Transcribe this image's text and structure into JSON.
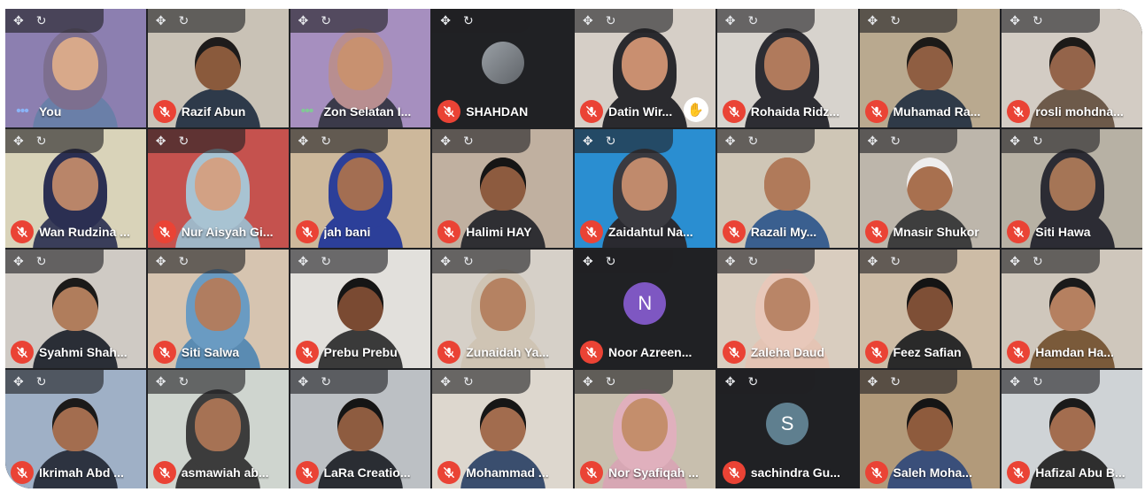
{
  "controls": {
    "move_icon": "✥",
    "refresh_icon": "↻"
  },
  "colors": {
    "mic_off": "#ea4335",
    "self_highlight": "#64d8cb",
    "tile_bg": "#3c4043"
  },
  "participants": [
    {
      "name": "You",
      "state": "talking",
      "avatar": "",
      "hijab": true,
      "bg": "#8c7fb0",
      "skin": "#d8a98a",
      "cloth": "#6a7fa8",
      "head": "#7d6f8f"
    },
    {
      "name": "Razif Abun",
      "state": "muted",
      "avatar": "",
      "hijab": false,
      "bg": "#c9c2b6",
      "skin": "#8a5a3c",
      "cloth": "#2e3a4a",
      "head": "#1d1b1b"
    },
    {
      "name": "Zon Selatan I...",
      "state": "talking-green",
      "avatar": "",
      "hijab": true,
      "bg": "#a68fbf",
      "skin": "#c89170",
      "cloth": "#3b3a4a",
      "head": "#b88e90"
    },
    {
      "name": "SHAHDAN",
      "state": "muted",
      "avatar": "photo",
      "letter": "",
      "hijab": false,
      "bg": "#202124"
    },
    {
      "name": "Datin Wir...",
      "state": "muted-hand",
      "avatar": "",
      "hijab": true,
      "bg": "#d6cfc7",
      "skin": "#c98f70",
      "cloth": "#2a2a2e",
      "head": "#2a2a2e"
    },
    {
      "name": "Rohaida Ridz...",
      "state": "muted",
      "avatar": "",
      "hijab": true,
      "bg": "#d7d3cd",
      "skin": "#b07a5c",
      "cloth": "#2d2d33",
      "head": "#2d2d33"
    },
    {
      "name": "Muhamad Ra...",
      "state": "muted",
      "avatar": "",
      "hijab": false,
      "bg": "#b9a98f",
      "skin": "#8f5e42",
      "cloth": "#2f3a48",
      "head": "#1c1a18"
    },
    {
      "name": "rosli mohdna...",
      "state": "muted",
      "avatar": "",
      "hijab": false,
      "bg": "#d3ccc4",
      "skin": "#94644a",
      "cloth": "#6d5a4a",
      "head": "#1c1a18"
    },
    {
      "name": "Wan Rudzina ...",
      "state": "muted",
      "avatar": "",
      "hijab": true,
      "bg": "#d9d3b9",
      "skin": "#b98569",
      "cloth": "#3a3e5a",
      "head": "#2b2f52"
    },
    {
      "name": "Nur Aisyah Gi...",
      "state": "muted",
      "avatar": "",
      "hijab": true,
      "bg": "#c5524e",
      "skin": "#d2a184",
      "cloth": "#9fb6c6",
      "head": "#a8c3d2"
    },
    {
      "name": "jah bani",
      "state": "muted",
      "avatar": "",
      "hijab": true,
      "bg": "#cdb89b",
      "skin": "#a36e52",
      "cloth": "#2c3f99",
      "head": "#2c3f99"
    },
    {
      "name": "Halimi HAY",
      "state": "muted",
      "avatar": "",
      "hijab": false,
      "bg": "#c0b0a0",
      "skin": "#8d5b3f",
      "cloth": "#2f2f33",
      "head": "#151515"
    },
    {
      "name": "Zaidahtul Na...",
      "state": "muted",
      "avatar": "",
      "hijab": true,
      "bg": "#2a8ed1",
      "skin": "#c08a6c",
      "cloth": "#2a2a30",
      "head": "#3a3a40"
    },
    {
      "name": "Razali My...",
      "state": "muted",
      "avatar": "",
      "hijab": false,
      "bg": "#cfc6b6",
      "skin": "#b07a5a",
      "cloth": "#3a5f8f",
      "head": "#b07a5a"
    },
    {
      "name": "Mnasir Shukor",
      "state": "muted",
      "avatar": "",
      "hijab": false,
      "bg": "#bdb6ab",
      "skin": "#a8704f",
      "cloth": "#3e3e3e",
      "head": "#eeeeee"
    },
    {
      "name": "Siti Hawa",
      "state": "muted",
      "avatar": "",
      "hijab": true,
      "bg": "#b7b1a4",
      "skin": "#a57556",
      "cloth": "#2c2c34",
      "head": "#2c2c34"
    },
    {
      "name": "Syahmi Shah...",
      "state": "muted",
      "avatar": "",
      "hijab": false,
      "bg": "#cfcac4",
      "skin": "#b07d5c",
      "cloth": "#2a2e36",
      "head": "#1b1a19"
    },
    {
      "name": "Siti Salwa",
      "state": "muted",
      "avatar": "",
      "hijab": true,
      "bg": "#d6c4b0",
      "skin": "#b07d60",
      "cloth": "#5a8bb2",
      "head": "#6a9bc2"
    },
    {
      "name": "Prebu Prebu",
      "state": "muted",
      "avatar": "",
      "hijab": false,
      "bg": "#e2e0dc",
      "skin": "#7a4a32",
      "cloth": "#3a3a3a",
      "head": "#151515"
    },
    {
      "name": "Zunaidah Ya...",
      "state": "muted",
      "avatar": "",
      "hijab": true,
      "bg": "#d6d0c8",
      "skin": "#b58262",
      "cloth": "#cfc4b4",
      "head": "#cfc4b4"
    },
    {
      "name": "Noor Azreen...",
      "state": "muted",
      "avatar": "letter",
      "letter": "N",
      "hijab": false,
      "bg": "#202124",
      "avatar_color": "#7e57c2"
    },
    {
      "name": "Zaleha Daud",
      "state": "muted",
      "avatar": "",
      "hijab": true,
      "bg": "#d9cdbf",
      "skin": "#b98567",
      "cloth": "#e4c4b4",
      "head": "#e8c8ba"
    },
    {
      "name": "Feez Safian",
      "state": "muted",
      "avatar": "",
      "hijab": false,
      "bg": "#cdbca6",
      "skin": "#7e4f36",
      "cloth": "#2a2a2a",
      "head": "#141414"
    },
    {
      "name": "Hamdan Ha...",
      "state": "muted",
      "avatar": "",
      "hijab": false,
      "bg": "#cfc7bc",
      "skin": "#b58060",
      "cloth": "#7a5a3a",
      "head": "#1a1a1a"
    },
    {
      "name": "Ikrimah Abd ...",
      "state": "muted",
      "avatar": "",
      "hijab": false,
      "bg": "#9fb0c6",
      "skin": "#a36d4f",
      "cloth": "#2d3340",
      "head": "#1b1a1a"
    },
    {
      "name": "asmawiah ab...",
      "state": "muted",
      "avatar": "",
      "hijab": true,
      "bg": "#cfd5cf",
      "skin": "#a67254",
      "cloth": "#3c3c3c",
      "head": "#3c3c3c"
    },
    {
      "name": "LaRa Creatio...",
      "state": "muted",
      "avatar": "",
      "hijab": false,
      "bg": "#bcc0c4",
      "skin": "#8e5c40",
      "cloth": "#2a2d33",
      "head": "#151515"
    },
    {
      "name": "Mohammad ...",
      "state": "muted",
      "avatar": "",
      "hijab": false,
      "bg": "#ddd7ce",
      "skin": "#a26c4e",
      "cloth": "#3a4e6e",
      "head": "#161616"
    },
    {
      "name": "Nor Syafiqah ...",
      "state": "muted",
      "avatar": "",
      "hijab": true,
      "bg": "#c8bfae",
      "skin": "#c48e6c",
      "cloth": "#d7a7b4",
      "head": "#e0b0bd"
    },
    {
      "name": "sachindra Gu...",
      "state": "muted",
      "avatar": "letter",
      "letter": "S",
      "hijab": false,
      "bg": "#202124",
      "avatar_color": "#5f7f8f"
    },
    {
      "name": "Saleh Moha...",
      "state": "muted",
      "avatar": "",
      "hijab": false,
      "bg": "#b29a7a",
      "skin": "#8e5b3d",
      "cloth": "#3a4f7a",
      "head": "#151515"
    },
    {
      "name": "Hafizal Abu B...",
      "state": "muted",
      "avatar": "",
      "hijab": false,
      "bg": "#cfd3d6",
      "skin": "#a36d4f",
      "cloth": "#2e2e2e",
      "head": "#1a1a1a"
    }
  ]
}
